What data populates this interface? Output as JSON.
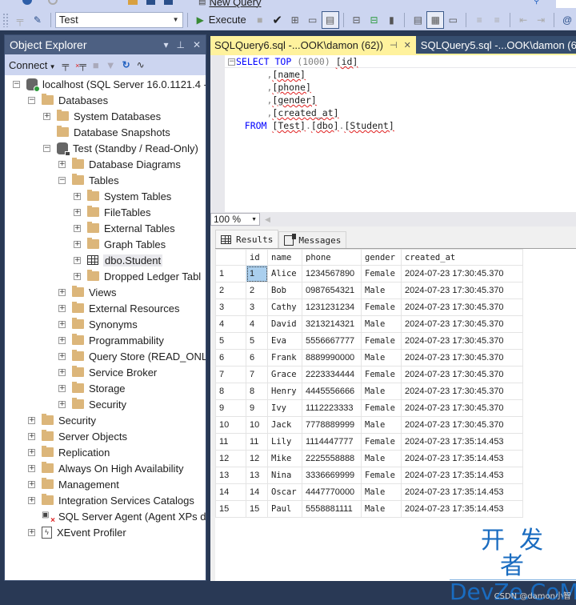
{
  "toolbar": {
    "new_query_label": "New Query",
    "database_selected": "Test",
    "execute_label": "Execute"
  },
  "object_explorer": {
    "title": "Object Explorer",
    "connect_label": "Connect",
    "tree": [
      {
        "label": "localhost (SQL Server 16.0.1121.4 -",
        "level": 0,
        "expander": "minus",
        "icon": "server-icon"
      },
      {
        "label": "Databases",
        "level": 1,
        "expander": "minus",
        "icon": "folder-icon"
      },
      {
        "label": "System Databases",
        "level": 2,
        "expander": "plus",
        "icon": "folder-icon"
      },
      {
        "label": "Database Snapshots",
        "level": 2,
        "expander": "none",
        "icon": "folder-icon"
      },
      {
        "label": "Test (Standby / Read-Only)",
        "level": 2,
        "expander": "minus",
        "icon": "database-readonly-icon"
      },
      {
        "label": "Database Diagrams",
        "level": 3,
        "expander": "plus",
        "icon": "folder-icon"
      },
      {
        "label": "Tables",
        "level": 3,
        "expander": "minus",
        "icon": "folder-icon"
      },
      {
        "label": "System Tables",
        "level": 4,
        "expander": "plus",
        "icon": "folder-icon"
      },
      {
        "label": "FileTables",
        "level": 4,
        "expander": "plus",
        "icon": "folder-icon"
      },
      {
        "label": "External Tables",
        "level": 4,
        "expander": "plus",
        "icon": "folder-icon"
      },
      {
        "label": "Graph Tables",
        "level": 4,
        "expander": "plus",
        "icon": "folder-icon"
      },
      {
        "label": "dbo.Student",
        "level": 4,
        "expander": "plus",
        "icon": "table-icon",
        "selected": true
      },
      {
        "label": "Dropped Ledger Tabl",
        "level": 4,
        "expander": "plus",
        "icon": "folder-icon"
      },
      {
        "label": "Views",
        "level": 3,
        "expander": "plus",
        "icon": "folder-icon"
      },
      {
        "label": "External Resources",
        "level": 3,
        "expander": "plus",
        "icon": "folder-icon"
      },
      {
        "label": "Synonyms",
        "level": 3,
        "expander": "plus",
        "icon": "folder-icon"
      },
      {
        "label": "Programmability",
        "level": 3,
        "expander": "plus",
        "icon": "folder-icon"
      },
      {
        "label": "Query Store (READ_ONLY",
        "level": 3,
        "expander": "plus",
        "icon": "folder-icon"
      },
      {
        "label": "Service Broker",
        "level": 3,
        "expander": "plus",
        "icon": "folder-icon"
      },
      {
        "label": "Storage",
        "level": 3,
        "expander": "plus",
        "icon": "folder-icon"
      },
      {
        "label": "Security",
        "level": 3,
        "expander": "plus",
        "icon": "folder-icon"
      },
      {
        "label": "Security",
        "level": 1,
        "expander": "plus",
        "icon": "folder-icon"
      },
      {
        "label": "Server Objects",
        "level": 1,
        "expander": "plus",
        "icon": "folder-icon"
      },
      {
        "label": "Replication",
        "level": 1,
        "expander": "plus",
        "icon": "folder-icon"
      },
      {
        "label": "Always On High Availability",
        "level": 1,
        "expander": "plus",
        "icon": "folder-icon"
      },
      {
        "label": "Management",
        "level": 1,
        "expander": "plus",
        "icon": "folder-icon"
      },
      {
        "label": "Integration Services Catalogs",
        "level": 1,
        "expander": "plus",
        "icon": "folder-icon"
      },
      {
        "label": "SQL Server Agent (Agent XPs di",
        "level": 1,
        "expander": "none",
        "icon": "agent-stopped-icon"
      },
      {
        "label": "XEvent Profiler",
        "level": 1,
        "expander": "plus",
        "icon": "xevent-icon"
      }
    ]
  },
  "editor": {
    "tabs": [
      {
        "label": "SQLQuery6.sql -...OOK\\damon (62))",
        "active": true
      },
      {
        "label": "SQLQuery5.sql -...OOK\\damon (6",
        "active": false
      }
    ],
    "query": {
      "select": "SELECT",
      "top": "TOP",
      "top_value": "(1000)",
      "columns": [
        "[id]",
        "[name]",
        "[phone]",
        "[gender]",
        "[created_at]"
      ],
      "from": "FROM",
      "table": [
        "[Test]",
        "[dbo]",
        "[Student]"
      ]
    },
    "zoom_level": "100 %"
  },
  "results": {
    "tabs": [
      {
        "label": "Results",
        "active": true
      },
      {
        "label": "Messages",
        "active": false
      }
    ],
    "columns": [
      "id",
      "name",
      "phone",
      "gender",
      "created_at"
    ],
    "rows": [
      [
        "1",
        "Alice",
        "1234567890",
        "Female",
        "2024-07-23 17:30:45.370"
      ],
      [
        "2",
        "Bob",
        "0987654321",
        "Male",
        "2024-07-23 17:30:45.370"
      ],
      [
        "3",
        "Cathy",
        "1231231234",
        "Female",
        "2024-07-23 17:30:45.370"
      ],
      [
        "4",
        "David",
        "3213214321",
        "Male",
        "2024-07-23 17:30:45.370"
      ],
      [
        "5",
        "Eva",
        "5556667777",
        "Female",
        "2024-07-23 17:30:45.370"
      ],
      [
        "6",
        "Frank",
        "8889990000",
        "Male",
        "2024-07-23 17:30:45.370"
      ],
      [
        "7",
        "Grace",
        "2223334444",
        "Female",
        "2024-07-23 17:30:45.370"
      ],
      [
        "8",
        "Henry",
        "4445556666",
        "Male",
        "2024-07-23 17:30:45.370"
      ],
      [
        "9",
        "Ivy",
        "1112223333",
        "Female",
        "2024-07-23 17:30:45.370"
      ],
      [
        "10",
        "Jack",
        "7778889999",
        "Male",
        "2024-07-23 17:30:45.370"
      ],
      [
        "11",
        "Lily",
        "1114447777",
        "Female",
        "2024-07-23 17:35:14.453"
      ],
      [
        "12",
        "Mike",
        "2225558888",
        "Male",
        "2024-07-23 17:35:14.453"
      ],
      [
        "13",
        "Nina",
        "3336669999",
        "Female",
        "2024-07-23 17:35:14.453"
      ],
      [
        "14",
        "Oscar",
        "4447770000",
        "Male",
        "2024-07-23 17:35:14.453"
      ],
      [
        "15",
        "Paul",
        "5558881111",
        "Male",
        "2024-07-23 17:35:14.453"
      ]
    ]
  },
  "watermark": {
    "cn": "开发者",
    "en": "DevZe.CoM",
    "csdn": "CSDN @damon小智"
  }
}
